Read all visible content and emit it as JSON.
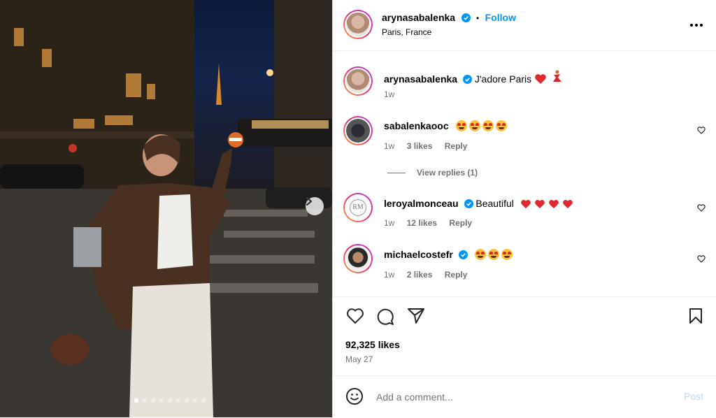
{
  "post": {
    "username": "arynasabalenka",
    "follow_label": "Follow",
    "separator": "•",
    "location": "Paris, France",
    "more_icon": "more-horizontal-icon"
  },
  "caption": {
    "username": "arynasabalenka",
    "text": "J'adore Paris",
    "time": "1w"
  },
  "comments": [
    {
      "username": "sabalenkaooc",
      "text": "",
      "emoji_count": 4,
      "time": "1w",
      "likes": "3 likes",
      "reply": "Reply",
      "view_replies": "View replies (1)"
    },
    {
      "username": "leroyalmonceau",
      "text": "Beautiful",
      "heart_count": 4,
      "time": "1w",
      "likes": "12 likes",
      "reply": "Reply"
    },
    {
      "username": "michaelcostefr",
      "text": "",
      "emoji_count": 3,
      "time": "1w",
      "likes": "2 likes",
      "reply": "Reply"
    }
  ],
  "engagement": {
    "likes": "92,325 likes",
    "date": "May 27"
  },
  "add_comment": {
    "placeholder": "Add a comment...",
    "post_label": "Post"
  },
  "carousel": {
    "slide_count": 9,
    "active_index": 0
  },
  "colors": {
    "accent": "#0095f6",
    "verified": "#0095f6",
    "muted": "#737373",
    "heart_red": "#e0282e"
  }
}
